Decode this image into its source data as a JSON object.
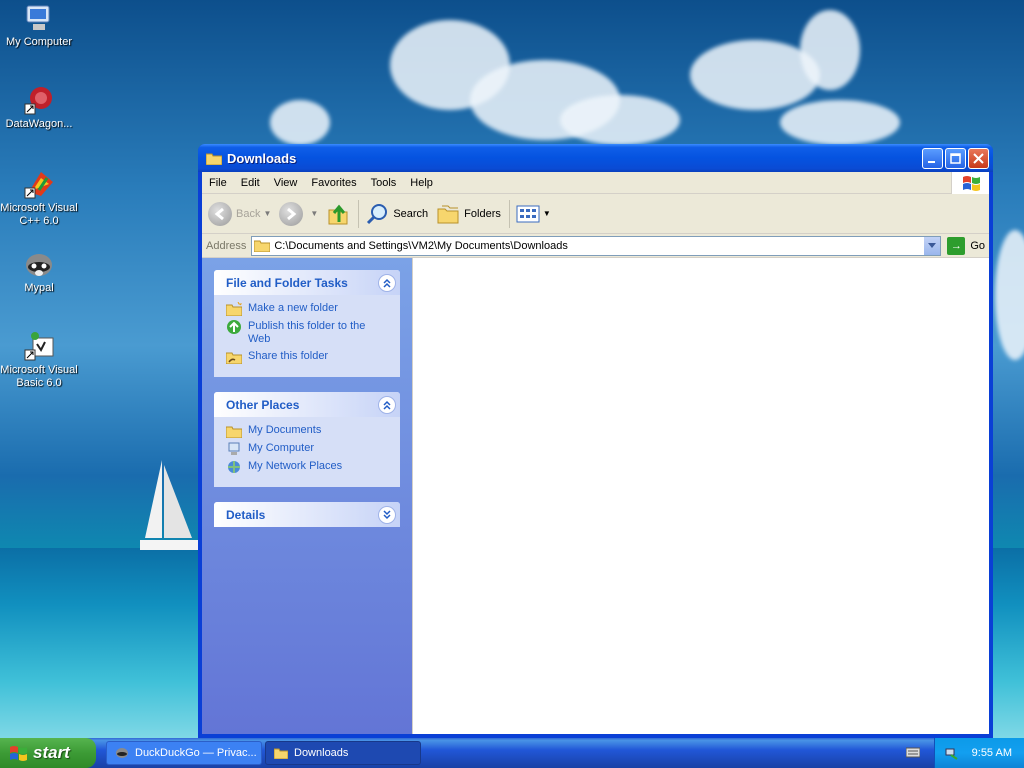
{
  "desktop": {
    "icons": [
      {
        "label": "My Computer"
      },
      {
        "label": "DataWagon..."
      },
      {
        "label": "Microsoft Visual C++ 6.0"
      },
      {
        "label": "Mypal"
      },
      {
        "label": "Microsoft Visual Basic 6.0"
      }
    ]
  },
  "window": {
    "title": "Downloads",
    "menu": [
      "File",
      "Edit",
      "View",
      "Favorites",
      "Tools",
      "Help"
    ],
    "toolbar": {
      "back": "Back",
      "search": "Search",
      "folders": "Folders"
    },
    "address": {
      "label": "Address",
      "value": "C:\\Documents and Settings\\VM2\\My Documents\\Downloads",
      "go": "Go"
    },
    "taskpane": {
      "file_tasks": {
        "title": "File and Folder Tasks",
        "links": [
          "Make a new folder",
          "Publish this folder to the Web",
          "Share this folder"
        ]
      },
      "other_places": {
        "title": "Other Places",
        "links": [
          "My Documents",
          "My Computer",
          "My Network Places"
        ]
      },
      "details": {
        "title": "Details"
      }
    }
  },
  "taskbar": {
    "start": "start",
    "tasks": [
      "DuckDuckGo — Privac...",
      "Downloads"
    ],
    "clock": "9:55 AM"
  },
  "colors": {
    "titlebar": "#0553e0",
    "link": "#215dc6",
    "start_green": "#3c9b35"
  }
}
